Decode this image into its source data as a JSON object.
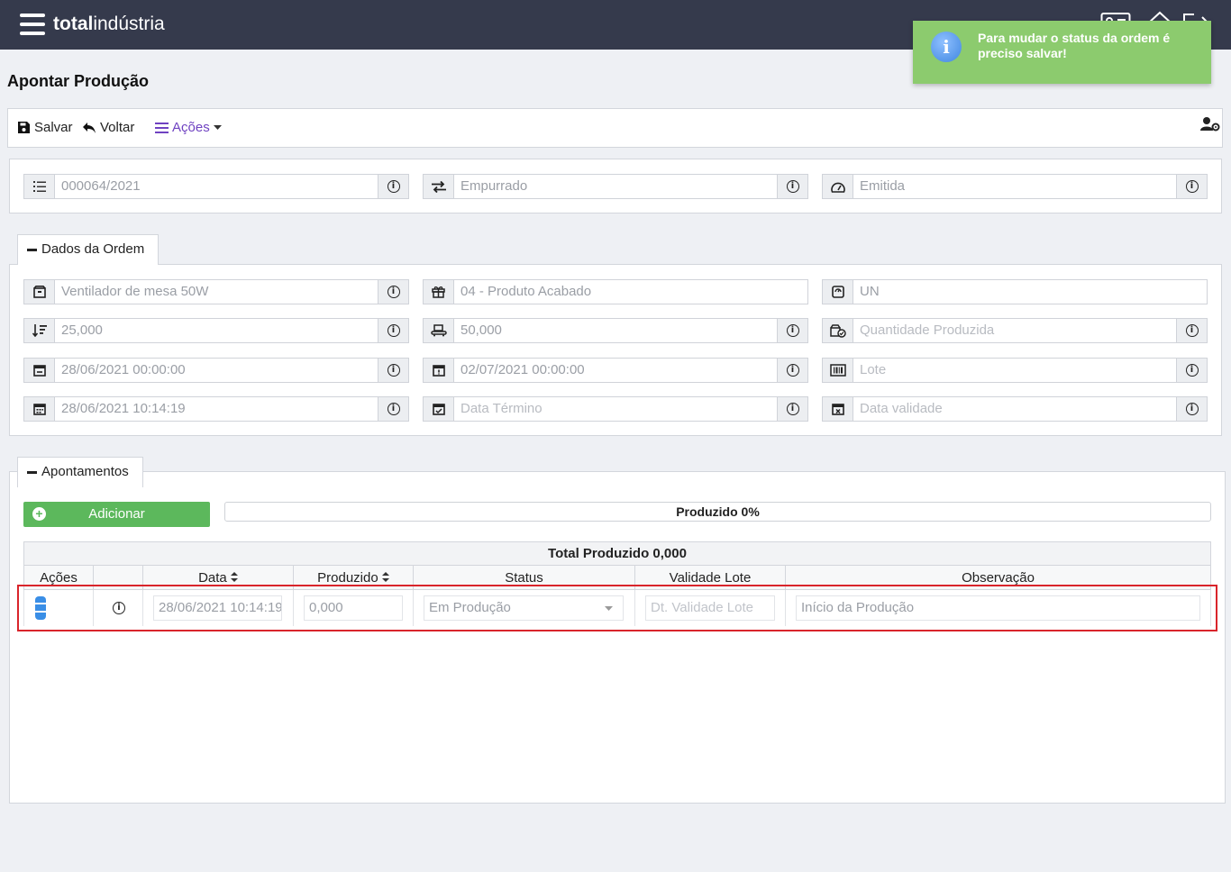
{
  "app": {
    "logo_bold": "total",
    "logo_rest": "indústria"
  },
  "toast": {
    "message": "Para mudar o status da ordem é preciso salvar!"
  },
  "page": {
    "title": "Apontar Produção"
  },
  "toolbar": {
    "save": "Salvar",
    "back": "Voltar",
    "actions": "Ações"
  },
  "header_fields": {
    "order_number": "000064/2021",
    "type": "Empurrado",
    "status": "Emitida"
  },
  "order_section": {
    "legend": "Dados da Ordem",
    "product": "Ventilador de mesa 50W",
    "product_type": "04 - Produto Acabado",
    "unit": "UN",
    "quantity": "25,000",
    "capacity": "50,000",
    "produced_qty_placeholder": "Quantidade Produzida",
    "start_planned": "28/06/2021 00:00:00",
    "end_planned": "02/07/2021 00:00:00",
    "lot_placeholder": "Lote",
    "start_date": "28/06/2021 10:14:19",
    "end_date_placeholder": "Data Término",
    "validity_placeholder": "Data validade"
  },
  "appointments": {
    "legend": "Apontamentos",
    "add_button": "Adicionar",
    "progress_label": "Produzido 0%",
    "progress_fraction": 0,
    "total_label": "Total Produzido 0,000",
    "columns": [
      "Ações",
      "",
      "Data",
      "Produzido",
      "Status",
      "Validade Lote",
      "Observação"
    ],
    "rows": [
      {
        "date": "28/06/2021 10:14:19",
        "produced": "0,000",
        "status": "Em Produção",
        "lot_validity_placeholder": "Dt. Validade Lote",
        "observation": "Início da Produção"
      }
    ]
  },
  "colors": {
    "topbar": "#353a4c",
    "toast": "#8ccb6e",
    "add_button": "#5cb85c",
    "accent_purple": "#6f42c1",
    "highlight_red": "#d9242b"
  }
}
